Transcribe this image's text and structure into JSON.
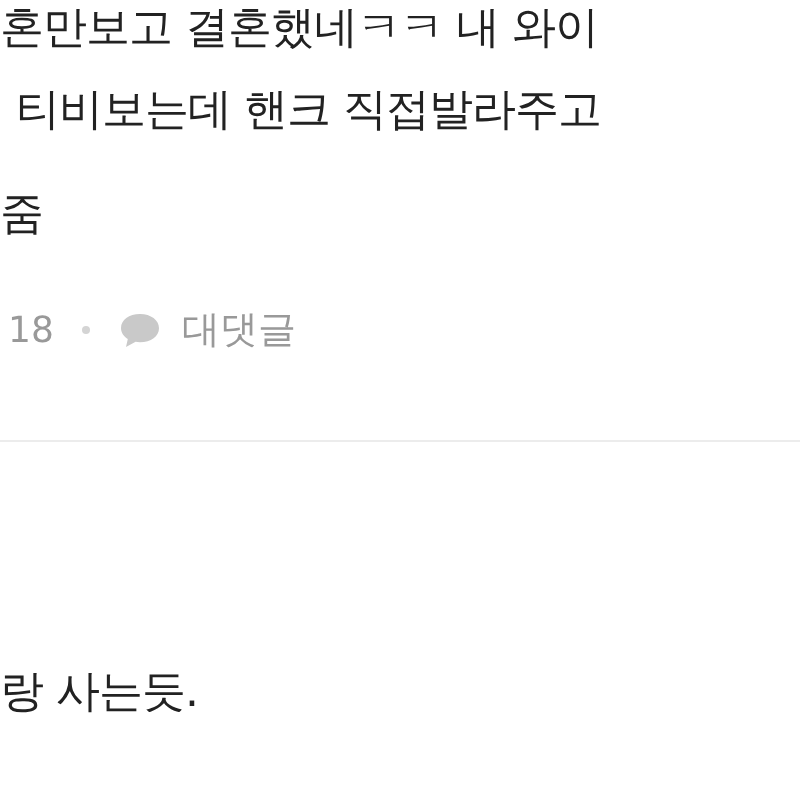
{
  "comments": [
    {
      "lines": [
        "혼만보고 결혼했네ㅋㅋ 내 와이",
        "티비보는데 핸크 직접발라주고",
        "줌"
      ],
      "likes": "18",
      "reply_label": "대댓글"
    },
    {
      "lines": [
        "랑 사는듯."
      ]
    }
  ]
}
